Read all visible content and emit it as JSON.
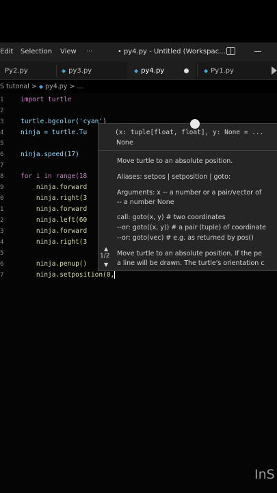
{
  "menu": {
    "edit": "Edit",
    "selection": "Selection",
    "view": "View",
    "more": "···"
  },
  "window_title": "py4.py - Untitled (Workspac...",
  "tabs": [
    {
      "label": "Py2.py"
    },
    {
      "label": "py3.py"
    },
    {
      "label": "py4.py",
      "active": true,
      "modified": true
    },
    {
      "label": "Py1.py"
    }
  ],
  "breadcrumb": {
    "folder": "S tutonal",
    "sep": ">",
    "file": "py4.py",
    "tail": "> ..."
  },
  "line_numbers": [
    "1",
    "2",
    "3",
    "4",
    "5",
    "6",
    "7",
    "8",
    "9",
    "0",
    "1",
    "2",
    "3",
    "4",
    "5",
    "6",
    "7"
  ],
  "code": [
    "import turtle",
    "",
    "turtle.bgcolor('cyan')",
    "ninja = turtle.Tu",
    "",
    "ninja.speed(17)",
    "",
    "for i in range(18",
    "    ninja.forward",
    "    ninja.right(3",
    "    ninja.forward",
    "    ninja.left(60",
    "    ninja.forward",
    "    ninja.right(3",
    "",
    "    ninja.penup()",
    "    ninja.setposition(0,"
  ],
  "hover": {
    "signature": "(x: tuple[float, float], y: None = ...",
    "signature_line2": "None",
    "lines": [
      "Move turtle to an absolute position.",
      "Aliases: setpos | setposition | goto:",
      "Arguments: x -- a number or a pair/vector of",
      "-- a number None",
      "call: goto(x, y) # two coordinates",
      "--or: goto((x, y)) # a pair (tuple) of coordinate",
      "--or: goto(vec) # e.g. as returned by pos()",
      "Move turtle to an absolute position. If the pe",
      "a line will be drawn. The turtle's orientation c"
    ],
    "counter": "1/2"
  },
  "watermark": "InS"
}
